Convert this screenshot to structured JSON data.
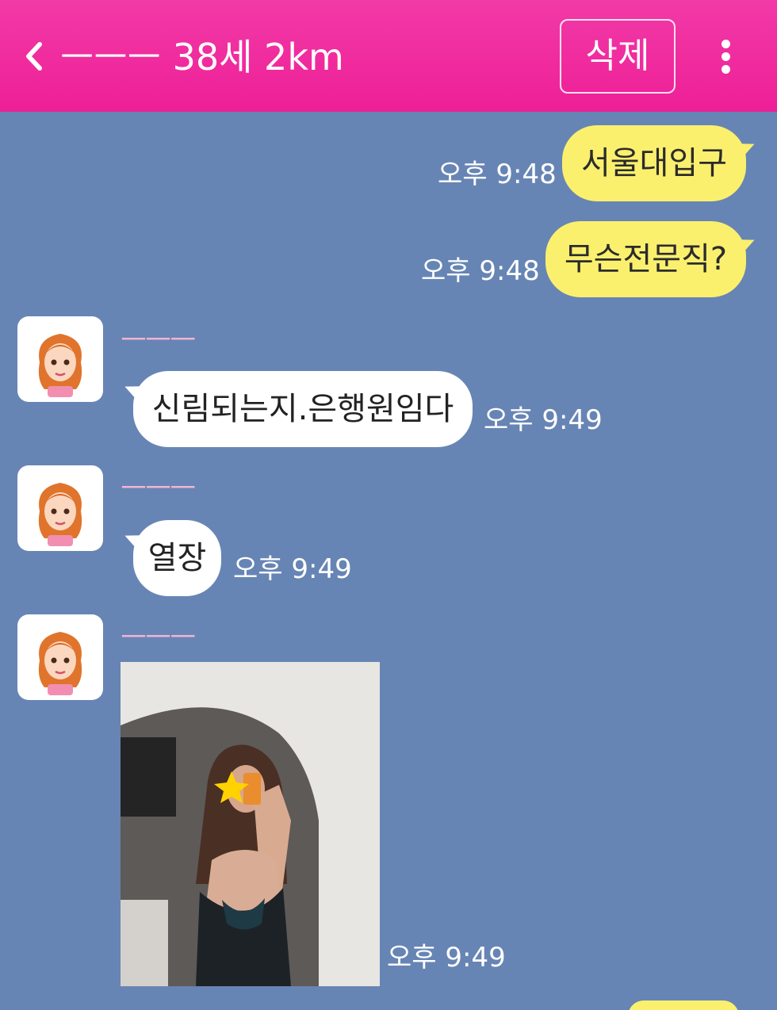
{
  "header": {
    "back_icon": "chevron-left-icon",
    "title": "ㅡㅡㅡ 38세 2km",
    "delete_label": "삭제",
    "more_icon": "more-vertical-icon"
  },
  "messages": [
    {
      "text": "서울대입구",
      "time": "오후 9:48"
    },
    {
      "text": "무슨전문직?",
      "time": "오후 9:48"
    },
    {
      "name": "ㅡㅡㅡ",
      "text": "신림되는지.은행원임다",
      "time": "오후 9:49"
    },
    {
      "name": "ㅡㅡㅡ",
      "text": "열장",
      "time": "오후 9:49"
    },
    {
      "name": "ㅡㅡㅡ",
      "time": "오후 9:49"
    }
  ],
  "colors": {
    "header": "#ee1f97",
    "background": "#6785b4",
    "my_bubble": "#fbf06e",
    "other_bubble": "#ffffff"
  }
}
